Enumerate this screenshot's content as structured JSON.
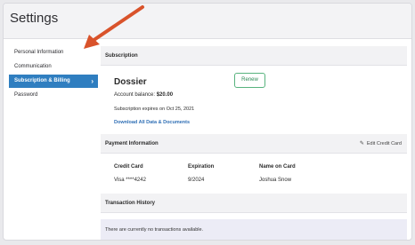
{
  "header": {
    "title": "Settings"
  },
  "sidebar": {
    "items": [
      {
        "label": "Personal Information"
      },
      {
        "label": "Communication"
      },
      {
        "label": "Subscription & Billing",
        "chevron": "›"
      },
      {
        "label": "Password"
      }
    ]
  },
  "subscription": {
    "section_title": "Subscription",
    "plan_name": "Dossier",
    "balance_label": "Account balance:",
    "balance_value": "$20.00",
    "renew_label": "Renew",
    "expires_text": "Subscription expires on Oct 25, 2021",
    "download_label": "Download All Data & Documents"
  },
  "payment": {
    "section_title": "Payment Information",
    "edit_label": "Edit Credit Card",
    "edit_icon": "pencil-icon",
    "columns": [
      "Credit Card",
      "Expiration",
      "Name on Card"
    ],
    "row": [
      "Visa ****4242",
      "9/2024",
      "Joshua Snow"
    ]
  },
  "transactions": {
    "section_title": "Transaction History",
    "empty_text": "There are currently no transactions available."
  },
  "colors": {
    "accent": "#2f7ec0",
    "renew": "#58b37e",
    "arrow": "#d9532b"
  }
}
